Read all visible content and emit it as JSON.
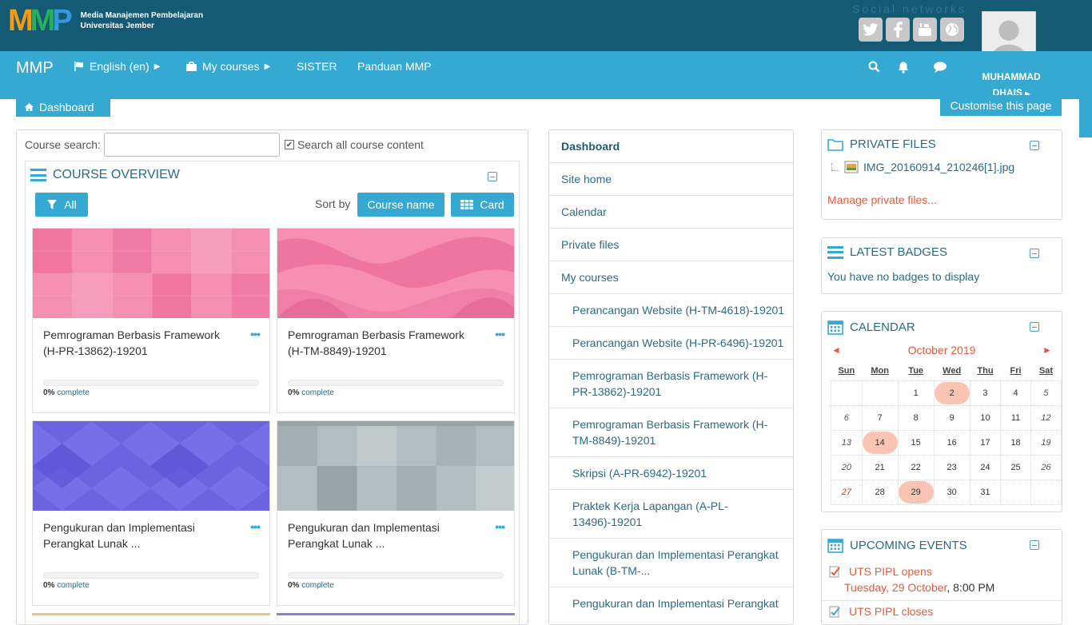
{
  "site": {
    "org_line1": "Media Manajemen Pembelajaran",
    "org_line2": "Universitas Jember",
    "social_title": "Social networks"
  },
  "nav": {
    "brand": "MMP",
    "language": "English ‎(en)‎",
    "my_courses": "My courses",
    "sister": "SISTER",
    "panduan": "Panduan MMP",
    "user_first": "MUHAMMAD",
    "user_last": "DHAIS"
  },
  "tabs": {
    "dashboard": "Dashboard",
    "customise": "Customise this page"
  },
  "search": {
    "label": "Course search:",
    "value": "",
    "all_content_label": "Search all course content"
  },
  "course_overview": {
    "title": "COURSE OVERVIEW",
    "filter_label": "All",
    "sort_by": "Sort by",
    "sort_value": "Course name",
    "view_value": "Card",
    "courses": [
      {
        "title": "Pemrograman Berbasis Framework (H-PR-13862)-19201",
        "progress": 0,
        "progress_label": "0%",
        "complete": " complete",
        "color": "#f48fb1"
      },
      {
        "title": "Pemrograman Berbasis Framework (H-TM-8849)-19201",
        "progress": 0,
        "progress_label": "0%",
        "complete": " complete",
        "color": "#f78fb3"
      },
      {
        "title": "Pengukuran dan Implementasi Perangkat Lunak ...",
        "progress": 0,
        "progress_label": "0%",
        "complete": " complete",
        "color": "#6c63e0"
      },
      {
        "title": "Pengukuran dan Implementasi Perangkat Lunak ...",
        "progress": 0,
        "progress_label": "0%",
        "complete": " complete",
        "color": "#b3bcbf"
      }
    ]
  },
  "navigation": {
    "items": [
      {
        "label": "Dashboard"
      },
      {
        "label": "Site home"
      },
      {
        "label": "Calendar"
      },
      {
        "label": "Private files"
      },
      {
        "label": "My courses"
      },
      {
        "label": "Perancangan Website (H-TM-4618)-19201"
      },
      {
        "label": "Perancangan Website (H-PR-6496)-19201"
      },
      {
        "label": "Pemrograman Berbasis Framework (H-PR-13862)-19201"
      },
      {
        "label": "Pemrograman Berbasis Framework (H-TM-8849)-19201"
      },
      {
        "label": "Skripsi (A-PR-6942)-19201"
      },
      {
        "label": "Praktek Kerja Lapangan (A-PL-13496)-19201"
      },
      {
        "label": "Pengukuran dan Implementasi Perangkat Lunak (B-TM-..."
      },
      {
        "label": "Pengukuran dan Implementasi Perangkat"
      }
    ]
  },
  "private_files": {
    "title": "PRIVATE FILES",
    "file_name": "IMG_20160914_210246[1].jpg",
    "manage_link": "Manage private files..."
  },
  "badges": {
    "title": "LATEST BADGES",
    "empty_text": "You have no badges to display"
  },
  "calendar": {
    "title": "CALENDAR",
    "prev": "◄",
    "next": "►",
    "month": "October 2019",
    "weekdays": [
      "Sun",
      "Mon",
      "Tue",
      "Wed",
      "Thu",
      "Fri",
      "Sat"
    ],
    "weeks": [
      [
        "",
        "",
        "1",
        "2",
        "3",
        "4",
        "5"
      ],
      [
        "6",
        "7",
        "8",
        "9",
        "10",
        "11",
        "12"
      ],
      [
        "13",
        "14",
        "15",
        "16",
        "17",
        "18",
        "19"
      ],
      [
        "20",
        "21",
        "22",
        "23",
        "24",
        "25",
        "26"
      ],
      [
        "27",
        "28",
        "29",
        "30",
        "31",
        "",
        ""
      ]
    ],
    "event_days": [
      "2",
      "14",
      "29"
    ]
  },
  "upcoming": {
    "title": "UPCOMING EVENTS",
    "events": [
      {
        "name": "UTS PIPL opens",
        "date_day": "Tuesday, 29 October",
        "date_time": ", 8:00 PM"
      },
      {
        "name": "UTS PIPL closes"
      }
    ]
  },
  "colors": {
    "header_dark": "#145a75",
    "navbar": "#36a9d3",
    "link": "#2c6b85",
    "accent_orange": "#e35b3b"
  }
}
